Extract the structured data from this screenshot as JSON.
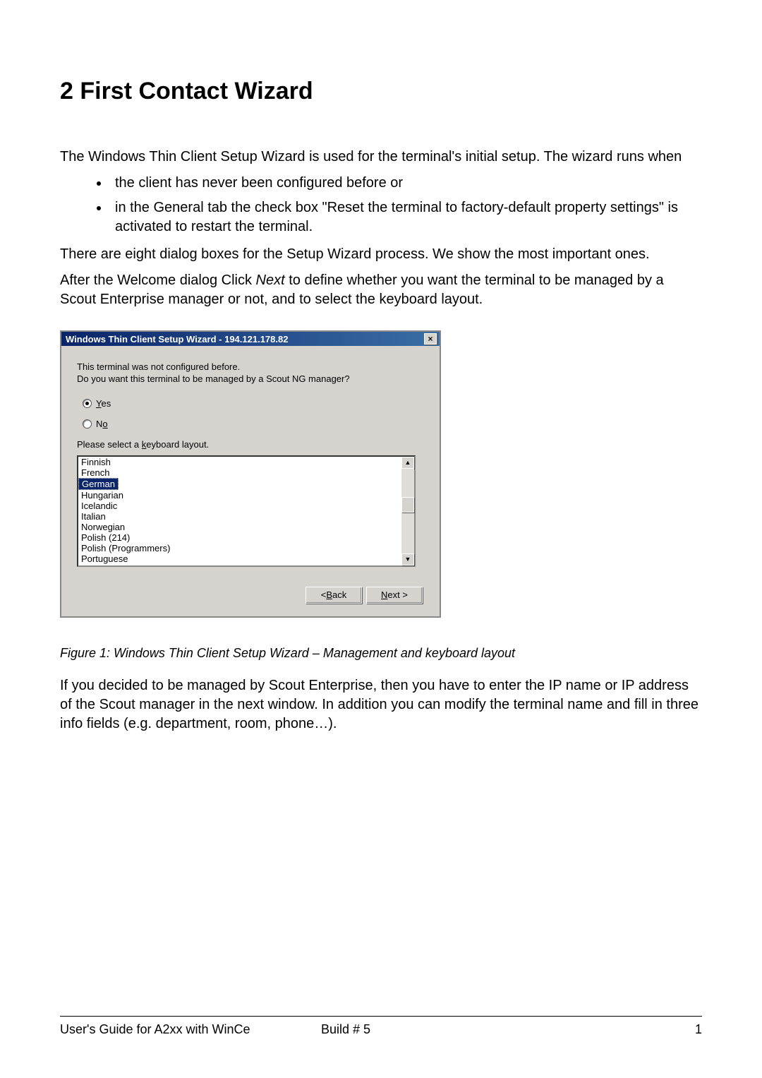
{
  "heading": "2   First Contact Wizard",
  "intro1": "The Windows Thin Client Setup Wizard is used for the terminal's initial setup. The wizard runs when",
  "bullets": [
    "the client has never been configured before or",
    "in the General tab the check box \"Reset the terminal to factory-default property settings\" is activated to restart the terminal."
  ],
  "para2": "There are eight dialog boxes for the Setup Wizard process. We show the most important ones.",
  "para3_before": "After the Welcome dialog Click ",
  "para3_italic": "Next",
  "para3_after": " to define whether you want the terminal to be managed by a Scout Enterprise manager or not, and to select the keyboard layout.",
  "wizard": {
    "title": "Windows Thin Client Setup Wizard - 194.121.178.82",
    "line1": "This terminal was not configured before.",
    "line2": "Do you want this terminal to be managed by a Scout NG manager?",
    "radio_yes_u": "Y",
    "radio_yes_rest": "es",
    "radio_no_first": "N",
    "radio_no_u": "o",
    "select_kbd_before": "Please select a ",
    "select_kbd_u": "k",
    "select_kbd_after": "eyboard layout.",
    "items": [
      "Finnish",
      "French",
      "German",
      "Hungarian",
      "Icelandic",
      "Italian",
      "Norwegian",
      "Polish (214)",
      "Polish (Programmers)",
      "Portuguese"
    ],
    "selected_index": 2,
    "back_lt": "< ",
    "back_u": "B",
    "back_rest": "ack",
    "next_u": "N",
    "next_rest": "ext >",
    "close_glyph": "×"
  },
  "caption": "Figure 1: Windows Thin Client Setup Wizard – Management and keyboard layout",
  "para4": "If you decided to be managed by Scout Enterprise, then you have to enter the IP name or IP address of the Scout manager in the next window. In addition you can modify the terminal name and fill in three info fields (e.g. department, room, phone…).",
  "footer": {
    "left": "User's Guide for A2xx with WinCe",
    "center": "Build # 5",
    "right": "1"
  }
}
